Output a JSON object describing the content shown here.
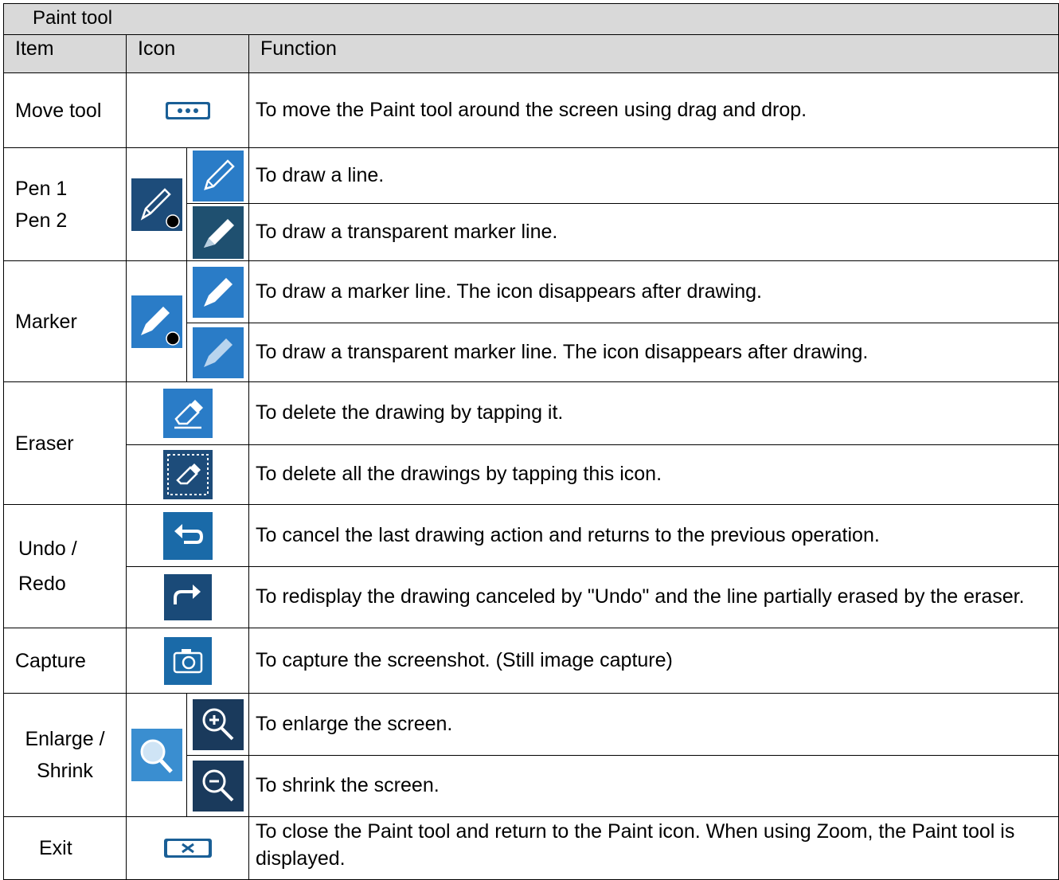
{
  "table": {
    "title": "Paint tool",
    "headers": {
      "item": "Item",
      "icon": "Icon",
      "function": "Function"
    },
    "rows": {
      "move": {
        "item": "Move tool",
        "function": "To move the Paint tool around the screen using drag and drop.",
        "icon": "move-handle-icon"
      },
      "pen": {
        "item_line1": "Pen 1",
        "item_line2": "Pen 2",
        "main_icon": "pen-dot-icon",
        "functions": [
          {
            "icon": "pen-icon",
            "text": "To draw a line."
          },
          {
            "icon": "marker-pen-icon",
            "text": "To draw a transparent marker line."
          }
        ]
      },
      "marker": {
        "item": "Marker",
        "main_icon": "marker-dot-icon",
        "functions": [
          {
            "icon": "marker-arrow-icon",
            "text": "To draw a marker line. The icon disappears after drawing."
          },
          {
            "icon": "marker-arrow-transparent-icon",
            "text": "To draw a transparent marker line. The icon disappears after drawing."
          }
        ]
      },
      "eraser": {
        "item": "Eraser",
        "functions": [
          {
            "icon": "eraser-icon",
            "text": "To delete the drawing by tapping it."
          },
          {
            "icon": "eraser-all-icon",
            "text": "To delete all the drawings by tapping this icon."
          }
        ]
      },
      "undo_redo": {
        "item_line1": "Undo /",
        "item_line2": "Redo",
        "functions": [
          {
            "icon": "undo-icon",
            "text": "To cancel the last drawing action and returns to the previous operation."
          },
          {
            "icon": "redo-icon",
            "text": "To redisplay the drawing canceled by \"Undo\" and the line partially erased by the eraser."
          }
        ]
      },
      "capture": {
        "item": "Capture",
        "icon": "camera-icon",
        "function": "To capture the screenshot. (Still image capture)"
      },
      "zoom": {
        "item_line1": "Enlarge /",
        "item_line2": "Shrink",
        "main_icon": "magnifier-icon",
        "functions": [
          {
            "icon": "zoom-in-icon",
            "text": "To enlarge the screen."
          },
          {
            "icon": "zoom-out-icon",
            "text": "To shrink the screen."
          }
        ]
      },
      "exit": {
        "item": "Exit",
        "icon": "close-tab-icon",
        "function": "To close the Paint tool and return to the Paint icon. When using Zoom, the Paint tool is displayed."
      }
    }
  },
  "colors": {
    "header_bg": "#d9d9d9",
    "icon_blue": "#2a7cc7",
    "icon_dark": "#1d4c7a",
    "icon_navy": "#1a3a5c"
  }
}
